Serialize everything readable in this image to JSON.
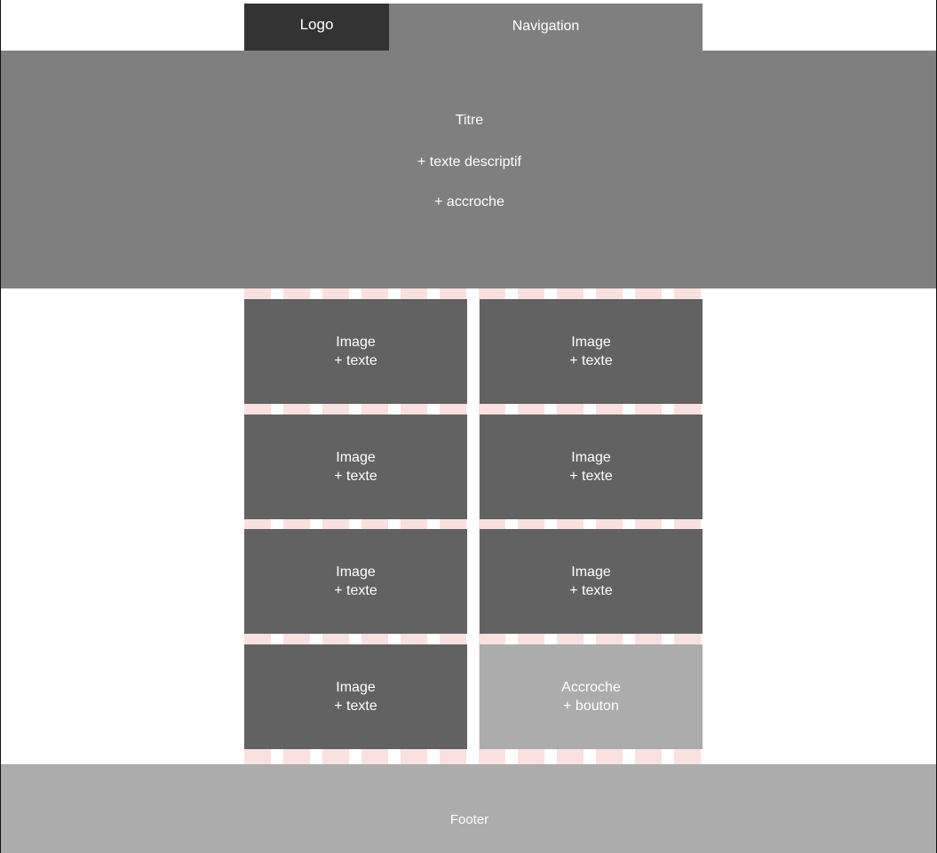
{
  "header": {
    "logo": "Logo",
    "navigation": "Navigation"
  },
  "hero": {
    "title": "Titre",
    "description": "+ texte descriptif",
    "hook": "+ accroche"
  },
  "tiles": [
    {
      "line1": "Image",
      "line2": "+ texte"
    },
    {
      "line1": "Image",
      "line2": "+ texte"
    },
    {
      "line1": "Image",
      "line2": "+ texte"
    },
    {
      "line1": "Image",
      "line2": "+ texte"
    },
    {
      "line1": "Image",
      "line2": "+ texte"
    },
    {
      "line1": "Image",
      "line2": "+ texte"
    },
    {
      "line1": "Image",
      "line2": "+ texte"
    },
    {
      "line1": "Accroche",
      "line2": "+ bouton"
    }
  ],
  "footer": {
    "label": "Footer"
  },
  "colors": {
    "logo_block": "#333333",
    "nav_block": "#7f7f7f",
    "hero_block": "#7f7f7f",
    "image_tile": "#626262",
    "cta_tile": "#acacac",
    "footer_block": "#acacac",
    "grid_guide": "#fbe0e0"
  }
}
